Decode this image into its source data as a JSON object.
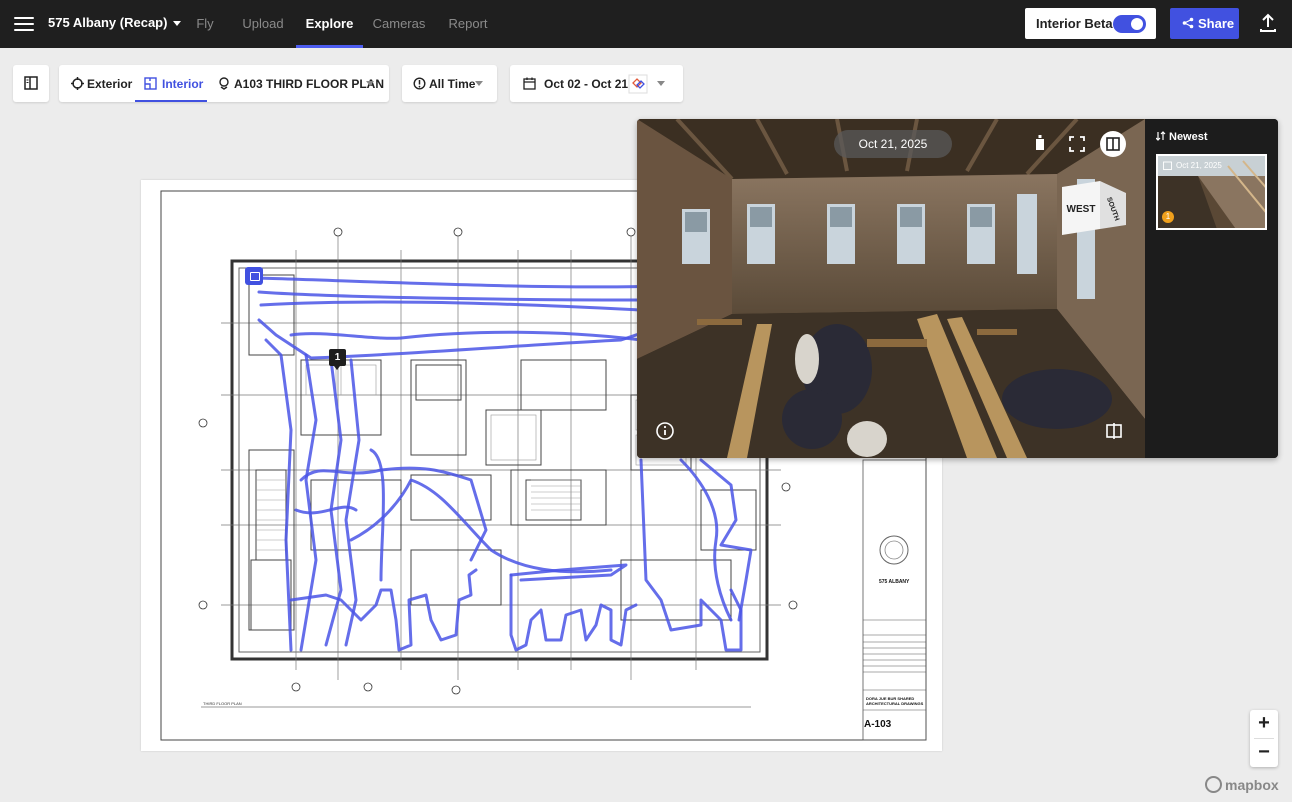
{
  "topbar": {
    "project_name": "575 Albany (Recap)",
    "nav_tabs": [
      {
        "label": "Fly",
        "active": false
      },
      {
        "label": "Upload",
        "active": false
      },
      {
        "label": "Explore",
        "active": true
      },
      {
        "label": "Cameras",
        "active": false
      },
      {
        "label": "Report",
        "active": false
      }
    ],
    "interior_beta_label": "Interior Beta",
    "interior_beta_on": true,
    "share_label": "Share"
  },
  "toolbar": {
    "exterior_label": "Exterior",
    "interior_label": "Interior",
    "floor_plan_label": "A103 THIRD FLOOR PLAN",
    "time_filter_label": "All Time",
    "date_range_label": "Oct 02 - Oct 21"
  },
  "plan": {
    "marker_label": "1",
    "sheet_project": "575 ALBANY",
    "sheet_title": "DORA JUE BUR SHARED ARCHITECTURAL DRAWINGS",
    "sheet_number": "A-103",
    "path_color": "#4a55e6"
  },
  "viewer": {
    "capture_date": "Oct 21, 2025",
    "cube_labels": [
      "WEST",
      "SOUTH"
    ],
    "sort_label": "Newest",
    "thumbnails": [
      {
        "date": "Oct 21, 2025",
        "badge": "1"
      }
    ]
  },
  "map": {
    "zoom_in": "+",
    "zoom_out": "−",
    "attribution": "mapbox"
  },
  "colors": {
    "accent": "#4151e0",
    "topbar_bg": "#1f1f1f"
  }
}
